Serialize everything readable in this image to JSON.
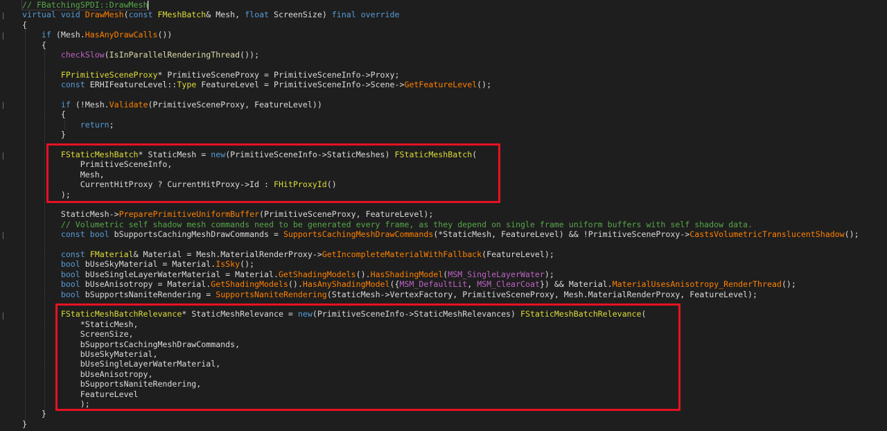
{
  "editor": {
    "lines": [
      [
        {
          "t": "// FBatchingSPDI::DrawMesh",
          "c": "com"
        }
      ],
      [
        {
          "t": "virtual void ",
          "c": "kw"
        },
        {
          "t": "DrawMesh",
          "c": "fn"
        },
        {
          "t": "(",
          "c": "plain"
        },
        {
          "t": "const ",
          "c": "kw"
        },
        {
          "t": "FMeshBatch",
          "c": "ctype"
        },
        {
          "t": "& Mesh, ",
          "c": "plain"
        },
        {
          "t": "float ",
          "c": "kw"
        },
        {
          "t": "ScreenSize) ",
          "c": "plain"
        },
        {
          "t": "final override",
          "c": "kw"
        }
      ],
      [
        {
          "t": "{",
          "c": "plain"
        }
      ],
      [
        {
          "t": "    ",
          "c": "plain"
        },
        {
          "t": "if ",
          "c": "kw"
        },
        {
          "t": "(Mesh.",
          "c": "plain"
        },
        {
          "t": "HasAnyDrawCalls",
          "c": "fn"
        },
        {
          "t": "())",
          "c": "plain"
        }
      ],
      [
        {
          "t": "    {",
          "c": "plain"
        }
      ],
      [
        {
          "t": "        ",
          "c": "plain"
        },
        {
          "t": "checkSlow",
          "c": "macro"
        },
        {
          "t": "(",
          "c": "plain"
        },
        {
          "t": "IsInParallelRenderingThread",
          "c": "fn2"
        },
        {
          "t": "());",
          "c": "plain"
        }
      ],
      [
        {
          "t": "",
          "c": "plain"
        }
      ],
      [
        {
          "t": "        ",
          "c": "plain"
        },
        {
          "t": "FPrimitiveSceneProxy",
          "c": "ctype"
        },
        {
          "t": "* PrimitiveSceneProxy = PrimitiveSceneInfo->Proxy;",
          "c": "plain"
        }
      ],
      [
        {
          "t": "        ",
          "c": "plain"
        },
        {
          "t": "const ",
          "c": "kw"
        },
        {
          "t": "ERHIFeatureLevel",
          "c": "plain"
        },
        {
          "t": "::",
          "c": "plain"
        },
        {
          "t": "Type",
          "c": "ctype"
        },
        {
          "t": " FeatureLevel = PrimitiveSceneInfo->Scene->",
          "c": "plain"
        },
        {
          "t": "GetFeatureLevel",
          "c": "fn"
        },
        {
          "t": "();",
          "c": "plain"
        }
      ],
      [
        {
          "t": "",
          "c": "plain"
        }
      ],
      [
        {
          "t": "        ",
          "c": "plain"
        },
        {
          "t": "if ",
          "c": "kw"
        },
        {
          "t": "(!Mesh.",
          "c": "plain"
        },
        {
          "t": "Validate",
          "c": "fn"
        },
        {
          "t": "(PrimitiveSceneProxy, FeatureLevel))",
          "c": "plain"
        }
      ],
      [
        {
          "t": "        {",
          "c": "plain"
        }
      ],
      [
        {
          "t": "            ",
          "c": "plain"
        },
        {
          "t": "return",
          "c": "kw"
        },
        {
          "t": ";",
          "c": "plain"
        }
      ],
      [
        {
          "t": "        }",
          "c": "plain"
        }
      ],
      [
        {
          "t": "",
          "c": "plain"
        }
      ],
      [
        {
          "t": "        ",
          "c": "plain"
        },
        {
          "t": "FStaticMeshBatch",
          "c": "ctype"
        },
        {
          "t": "* StaticMesh = ",
          "c": "plain"
        },
        {
          "t": "new",
          "c": "kw"
        },
        {
          "t": "(PrimitiveSceneInfo->StaticMeshes) ",
          "c": "plain"
        },
        {
          "t": "FStaticMeshBatch",
          "c": "ctype"
        },
        {
          "t": "(",
          "c": "plain"
        }
      ],
      [
        {
          "t": "            PrimitiveSceneInfo,",
          "c": "plain"
        }
      ],
      [
        {
          "t": "            Mesh,",
          "c": "plain"
        }
      ],
      [
        {
          "t": "            CurrentHitProxy ? CurrentHitProxy->Id : ",
          "c": "plain"
        },
        {
          "t": "FHitProxyId",
          "c": "ctype"
        },
        {
          "t": "()",
          "c": "plain"
        }
      ],
      [
        {
          "t": "        );",
          "c": "plain"
        }
      ],
      [
        {
          "t": "",
          "c": "plain"
        }
      ],
      [
        {
          "t": "        StaticMesh->",
          "c": "plain"
        },
        {
          "t": "PreparePrimitiveUniformBuffer",
          "c": "fn"
        },
        {
          "t": "(PrimitiveSceneProxy, FeatureLevel);",
          "c": "plain"
        }
      ],
      [
        {
          "t": "        ",
          "c": "plain"
        },
        {
          "t": "// Volumetric self shadow mesh commands need to be generated every frame, as they depend on single frame uniform buffers with self shadow data.",
          "c": "com"
        }
      ],
      [
        {
          "t": "        ",
          "c": "plain"
        },
        {
          "t": "const bool ",
          "c": "kw"
        },
        {
          "t": "bSupportsCachingMeshDrawCommands = ",
          "c": "plain"
        },
        {
          "t": "SupportsCachingMeshDrawCommands",
          "c": "fn"
        },
        {
          "t": "(*StaticMesh, FeatureLevel) && !PrimitiveSceneProxy->",
          "c": "plain"
        },
        {
          "t": "CastsVolumetricTranslucentShadow",
          "c": "fn"
        },
        {
          "t": "();",
          "c": "plain"
        }
      ],
      [
        {
          "t": "",
          "c": "plain"
        }
      ],
      [
        {
          "t": "        ",
          "c": "plain"
        },
        {
          "t": "const ",
          "c": "kw"
        },
        {
          "t": "FMaterial",
          "c": "ctype"
        },
        {
          "t": "& Material = Mesh.MaterialRenderProxy->",
          "c": "plain"
        },
        {
          "t": "GetIncompleteMaterialWithFallback",
          "c": "fn"
        },
        {
          "t": "(FeatureLevel);",
          "c": "plain"
        }
      ],
      [
        {
          "t": "        ",
          "c": "plain"
        },
        {
          "t": "bool ",
          "c": "kw"
        },
        {
          "t": "bUseSkyMaterial = Material.",
          "c": "plain"
        },
        {
          "t": "IsSky",
          "c": "fn"
        },
        {
          "t": "();",
          "c": "plain"
        }
      ],
      [
        {
          "t": "        ",
          "c": "plain"
        },
        {
          "t": "bool ",
          "c": "kw"
        },
        {
          "t": "bUseSingleLayerWaterMaterial = Material.",
          "c": "plain"
        },
        {
          "t": "GetShadingModels",
          "c": "fn"
        },
        {
          "t": "().",
          "c": "plain"
        },
        {
          "t": "HasShadingModel",
          "c": "fn"
        },
        {
          "t": "(",
          "c": "plain"
        },
        {
          "t": "MSM_SingleLayerWater",
          "c": "macro"
        },
        {
          "t": ");",
          "c": "plain"
        }
      ],
      [
        {
          "t": "        ",
          "c": "plain"
        },
        {
          "t": "bool ",
          "c": "kw"
        },
        {
          "t": "bUseAnisotropy = Material.",
          "c": "plain"
        },
        {
          "t": "GetShadingModels",
          "c": "fn"
        },
        {
          "t": "().",
          "c": "plain"
        },
        {
          "t": "HasAnyShadingModel",
          "c": "fn"
        },
        {
          "t": "({",
          "c": "plain"
        },
        {
          "t": "MSM_DefaultLit",
          "c": "macro"
        },
        {
          "t": ", ",
          "c": "plain"
        },
        {
          "t": "MSM_ClearCoat",
          "c": "macro"
        },
        {
          "t": "}) && Material.",
          "c": "plain"
        },
        {
          "t": "MaterialUsesAnisotropy_RenderThread",
          "c": "fn"
        },
        {
          "t": "();",
          "c": "plain"
        }
      ],
      [
        {
          "t": "        ",
          "c": "plain"
        },
        {
          "t": "bool ",
          "c": "kw"
        },
        {
          "t": "bSupportsNaniteRendering = ",
          "c": "plain"
        },
        {
          "t": "SupportsNaniteRendering",
          "c": "fn"
        },
        {
          "t": "(StaticMesh->VertexFactory, PrimitiveSceneProxy, Mesh.MaterialRenderProxy, FeatureLevel);",
          "c": "plain"
        }
      ],
      [
        {
          "t": "",
          "c": "plain"
        }
      ],
      [
        {
          "t": "        ",
          "c": "plain"
        },
        {
          "t": "FStaticMeshBatchRelevance",
          "c": "ctype"
        },
        {
          "t": "* StaticMeshRelevance = ",
          "c": "plain"
        },
        {
          "t": "new",
          "c": "kw"
        },
        {
          "t": "(PrimitiveSceneInfo->StaticMeshRelevances) ",
          "c": "plain"
        },
        {
          "t": "FStaticMeshBatchRelevance",
          "c": "ctype"
        },
        {
          "t": "(",
          "c": "plain"
        }
      ],
      [
        {
          "t": "            *StaticMesh,",
          "c": "plain"
        }
      ],
      [
        {
          "t": "            ScreenSize,",
          "c": "plain"
        }
      ],
      [
        {
          "t": "            bSupportsCachingMeshDrawCommands,",
          "c": "plain"
        }
      ],
      [
        {
          "t": "            bUseSkyMaterial,",
          "c": "plain"
        }
      ],
      [
        {
          "t": "            bUseSingleLayerWaterMaterial,",
          "c": "plain"
        }
      ],
      [
        {
          "t": "            bUseAnisotropy,",
          "c": "plain"
        }
      ],
      [
        {
          "t": "            bSupportsNaniteRendering,",
          "c": "plain"
        }
      ],
      [
        {
          "t": "            FeatureLevel",
          "c": "plain"
        }
      ],
      [
        {
          "t": "            );",
          "c": "plain"
        }
      ],
      [
        {
          "t": "    }",
          "c": "plain"
        }
      ],
      [
        {
          "t": "}",
          "c": "plain"
        }
      ]
    ]
  },
  "colors": {
    "background": "#1e1e1e",
    "highlight_border": "#e81123",
    "keyword": "#569cd6",
    "type": "#dcdc3a",
    "function": "#ff8000",
    "comment": "#57a64a",
    "macro": "#bd63c5",
    "text": "#dcdcdc"
  }
}
